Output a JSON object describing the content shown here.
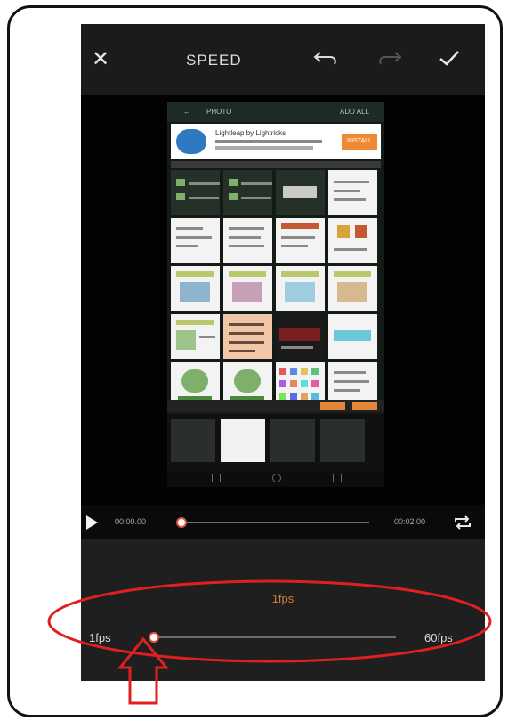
{
  "toolbar": {
    "title": "SPEED",
    "close_icon": "close-icon",
    "undo_icon": "undo-icon",
    "redo_icon": "redo-icon",
    "confirm_icon": "check-icon"
  },
  "preview": {
    "header_back": "←",
    "header_title": "PHOTO",
    "header_right": "ADD ALL",
    "banner_title": "Lightleap by Lightricks",
    "banner_button": "INSTALL"
  },
  "player": {
    "current_time": "00:00.00",
    "end_time": "00:02.00",
    "progress": 0.0
  },
  "speed": {
    "value_label": "1fps",
    "min_label": "1fps",
    "max_label": "60fps",
    "value": 1,
    "min": 1,
    "max": 60
  },
  "colors": {
    "accent": "#d27d33",
    "knob_ring": "#e0533f",
    "annotation": "#e02020"
  }
}
